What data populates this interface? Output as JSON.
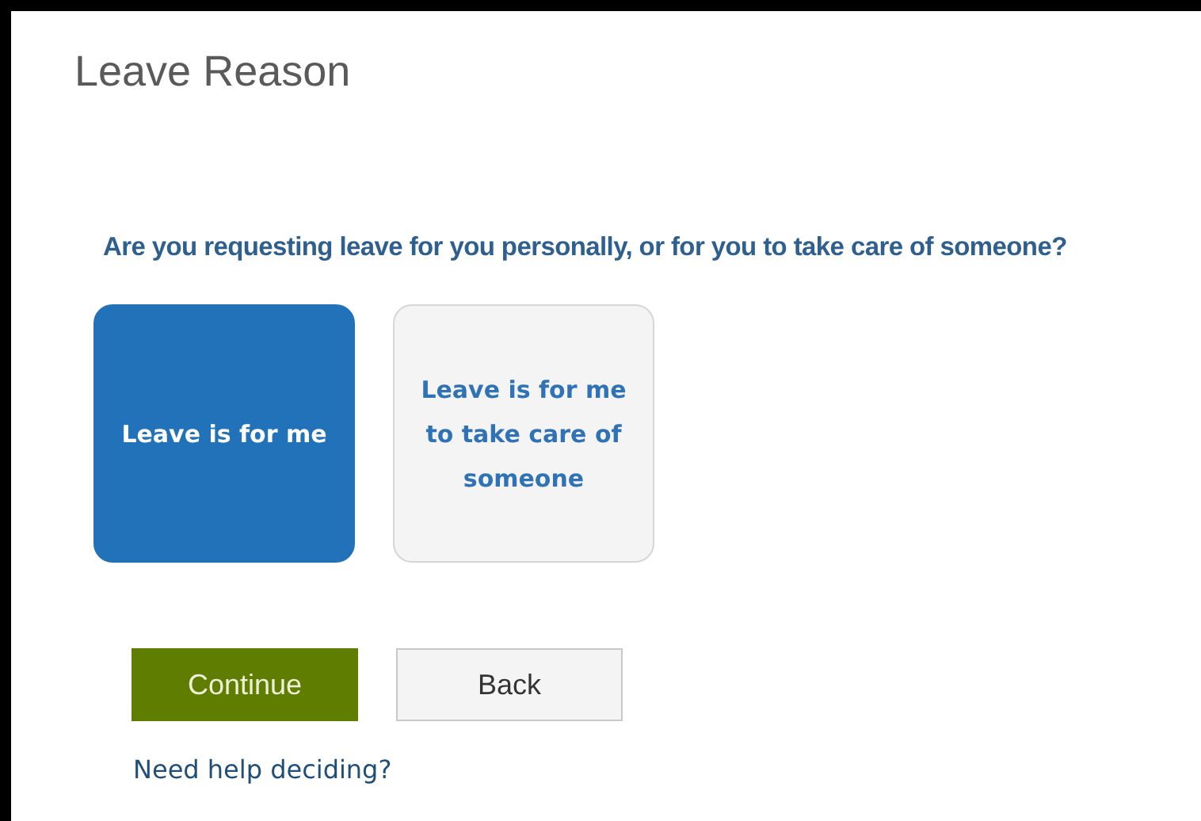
{
  "title": "Leave Reason",
  "question": "Are you requesting leave for you personally, or for you to take care of someone?",
  "options": [
    {
      "label": "Leave is for me",
      "selected": true
    },
    {
      "label": "Leave is for me to take care of someone",
      "selected": false
    }
  ],
  "buttons": [
    {
      "label": "Continue",
      "kind": "primary"
    },
    {
      "label": "Back",
      "kind": "secondary"
    }
  ],
  "help_link": "Need help deciding?"
}
